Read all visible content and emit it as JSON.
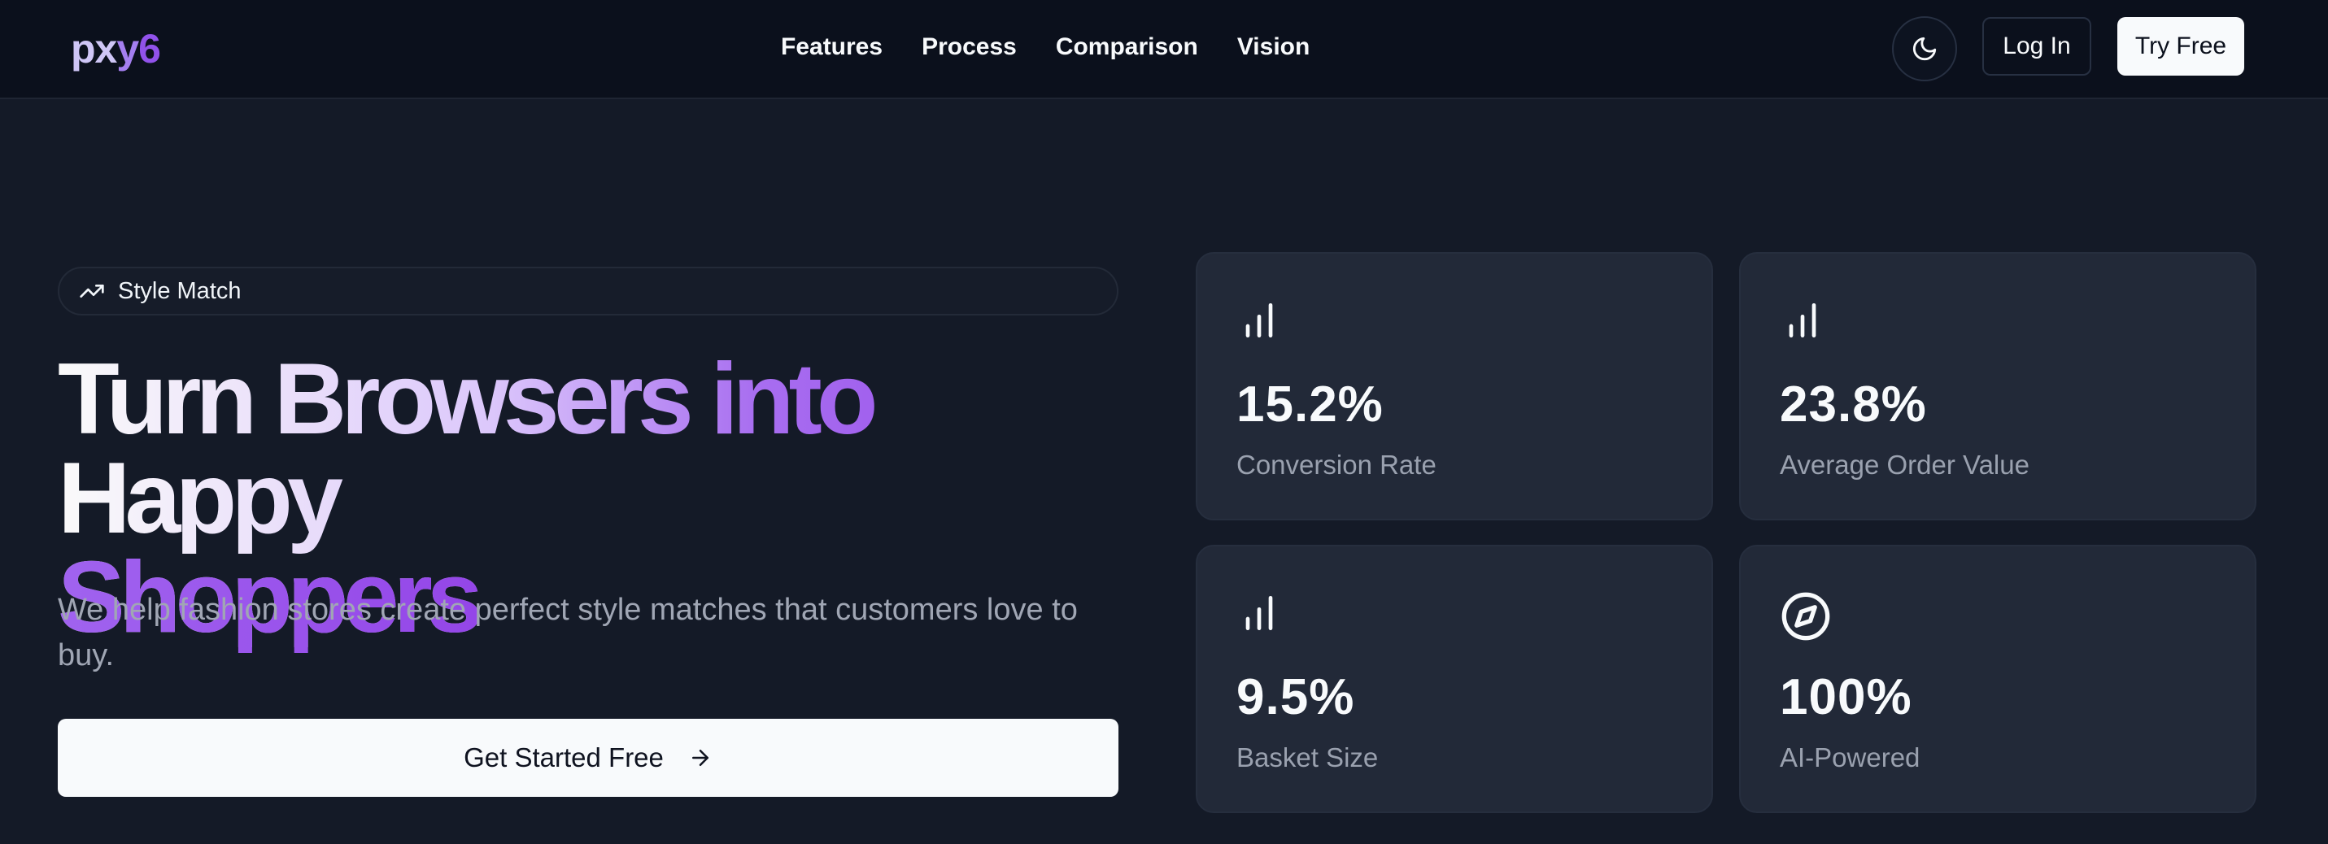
{
  "brand": {
    "logo_part1": "px",
    "logo_part2": "y",
    "logo_part3": "6"
  },
  "nav": {
    "links": [
      "Features",
      "Process",
      "Comparison",
      "Vision"
    ],
    "login_label": "Log In",
    "try_label": "Try Free",
    "theme_icon": "moon-icon"
  },
  "hero": {
    "badge_icon": "trending-up-icon",
    "badge_label": "Style Match",
    "headline_line1": "Turn Browsers into Happy",
    "headline_line2": "Shoppers",
    "subtitle": "We help fashion stores create perfect style matches that customers love to buy.",
    "cta_label": "Get Started Free",
    "cta_icon": "arrow-right-icon"
  },
  "stats": [
    {
      "icon": "bar-chart-icon",
      "value": "15.2%",
      "label": "Conversion Rate"
    },
    {
      "icon": "bar-chart-icon",
      "value": "23.8%",
      "label": "Average Order Value"
    },
    {
      "icon": "bar-chart-icon",
      "value": "9.5%",
      "label": "Basket Size"
    },
    {
      "icon": "compass-icon",
      "value": "100%",
      "label": "AI-Powered"
    }
  ],
  "colors": {
    "page_bg": "#141a27",
    "nav_bg": "#0b101c",
    "card_bg": "#222938",
    "accent_purple": "#9446e8",
    "button_light": "#f8fafc"
  }
}
